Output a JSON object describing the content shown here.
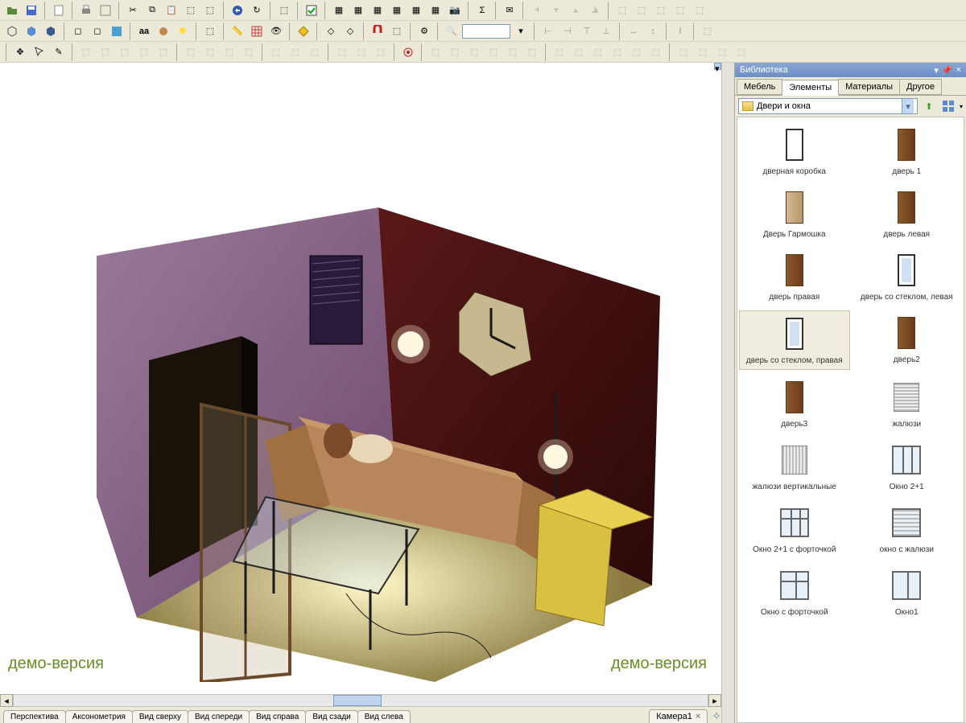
{
  "watermark": "демо-версия",
  "viewTabs": [
    "Перспектива",
    "Аксонометрия",
    "Вид сверху",
    "Вид спереди",
    "Вид справа",
    "Вид сзади",
    "Вид слева"
  ],
  "cameraTab": "Камера1",
  "panel": {
    "title": "Библиотека",
    "tabs": [
      "Мебель",
      "Элементы",
      "Материалы",
      "Другое"
    ],
    "activeTab": 1,
    "category": "Двери и окна",
    "items": [
      {
        "label": "дверная коробка",
        "type": "frame"
      },
      {
        "label": "дверь 1",
        "type": "wood"
      },
      {
        "label": "Дверь Гармошка",
        "type": "light"
      },
      {
        "label": "дверь левая",
        "type": "wood"
      },
      {
        "label": "дверь правая",
        "type": "wood"
      },
      {
        "label": "дверь со стеклом, левая",
        "type": "glass"
      },
      {
        "label": "дверь со стеклом, правая",
        "type": "glass",
        "selected": true
      },
      {
        "label": "дверь2",
        "type": "wood"
      },
      {
        "label": "дверь3",
        "type": "wood"
      },
      {
        "label": "жалюзи",
        "type": "blinds"
      },
      {
        "label": "жалюзи вертикальные",
        "type": "blinds-v"
      },
      {
        "label": "Окно 2+1",
        "type": "window21"
      },
      {
        "label": "Окно 2+1 с форточкой",
        "type": "window21f"
      },
      {
        "label": "окно с жалюзи",
        "type": "window-bl"
      },
      {
        "label": "Окно с форточкой",
        "type": "windowf"
      },
      {
        "label": "Окно1",
        "type": "window1"
      }
    ]
  }
}
